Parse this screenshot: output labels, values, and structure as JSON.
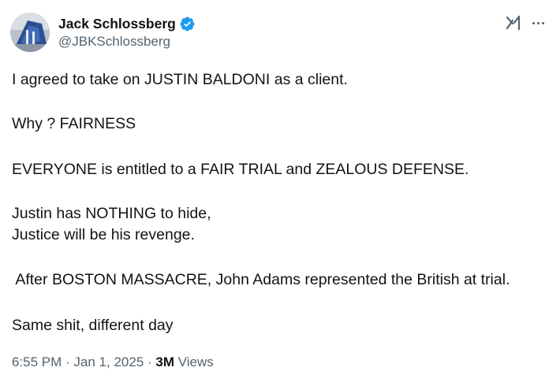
{
  "author": {
    "display_name": "Jack Schlossberg",
    "handle": "@JBKSchlossberg",
    "verified": true
  },
  "icons": {
    "verified": "verified-badge-icon",
    "grok": "grok-icon",
    "more": "more-options-icon"
  },
  "tweet": {
    "lines": [
      "I agreed to take on JUSTIN BALDONI as a client.",
      "Why ? FAIRNESS",
      "EVERYONE is entitled to a FAIR TRIAL and ZEALOUS DEFENSE.",
      "Justin has NOTHING to hide,",
      "Justice will be his revenge.",
      " After BOSTON MASSACRE, John Adams represented the British at trial.",
      "Same shit, different day"
    ]
  },
  "meta": {
    "time": "6:55 PM",
    "separator": " · ",
    "date": "Jan 1, 2025",
    "views_count": "3M",
    "views_label": " Views"
  },
  "colors": {
    "text": "#0f1419",
    "secondary": "#536471",
    "verified_blue": "#1d9bf0"
  }
}
